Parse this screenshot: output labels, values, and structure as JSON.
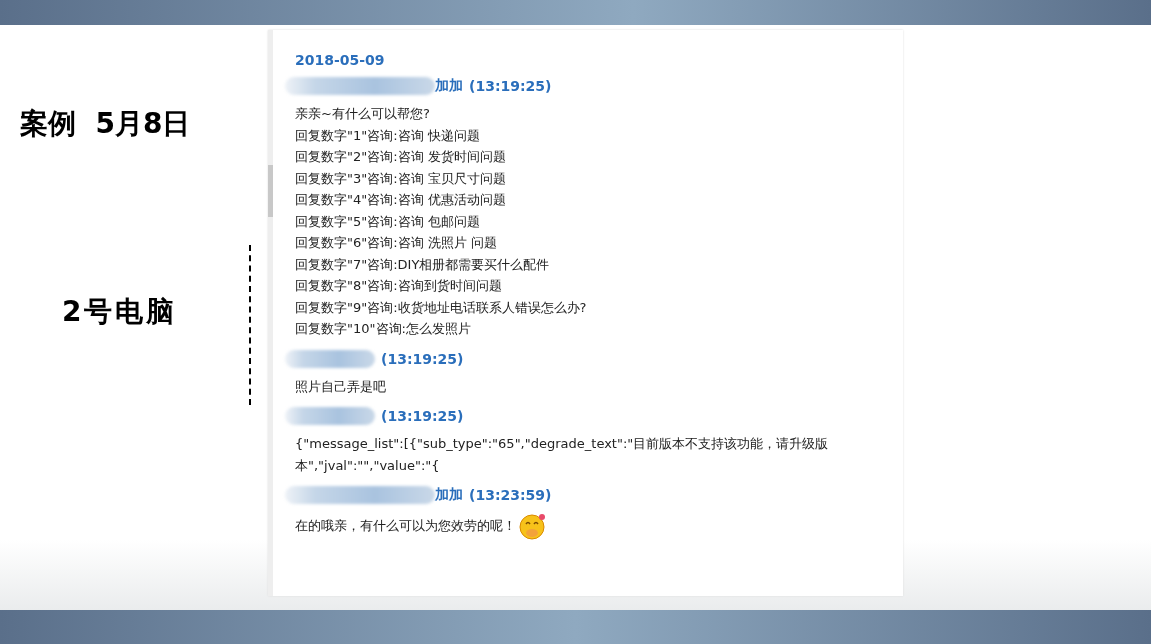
{
  "slide": {
    "title": "案例  5月8日",
    "subtitle": "2号电脑"
  },
  "chat": {
    "date": "2018-05-09",
    "messages": [
      {
        "sender": "加加",
        "time": "(13:19:25)",
        "lines": [
          "亲亲~有什么可以帮您?",
          "回复数字\"1\"咨询:咨询 快递问题",
          "回复数字\"2\"咨询:咨询 发货时间问题",
          "回复数字\"3\"咨询:咨询 宝贝尺寸问题",
          "回复数字\"4\"咨询:咨询 优惠活动问题",
          "回复数字\"5\"咨询:咨询 包邮问题",
          "回复数字\"6\"咨询:咨询 洗照片 问题",
          "回复数字\"7\"咨询:DIY相册都需要买什么配件",
          "回复数字\"8\"咨询:咨询到货时间问题",
          "回复数字\"9\"咨询:收货地址电话联系人错误怎么办?",
          "回复数字\"10\"咨询:怎么发照片"
        ],
        "emoji": false
      },
      {
        "time": "(13:19:25)",
        "lines": [
          "照片自己弄是吧"
        ],
        "emoji": false
      },
      {
        "time": "(13:19:25)",
        "lines": [
          "{\"message_list\":[{\"sub_type\":\"65\",\"degrade_text\":\"目前版本不支持该功能，请升级版本\",\"jval\":\"\",\"value\":\"{"
        ],
        "emoji": false
      },
      {
        "sender": "加加",
        "time": "(13:23:59)",
        "lines": [
          "在的哦亲，有什么可以为您效劳的呢！"
        ],
        "emoji": true
      }
    ]
  }
}
